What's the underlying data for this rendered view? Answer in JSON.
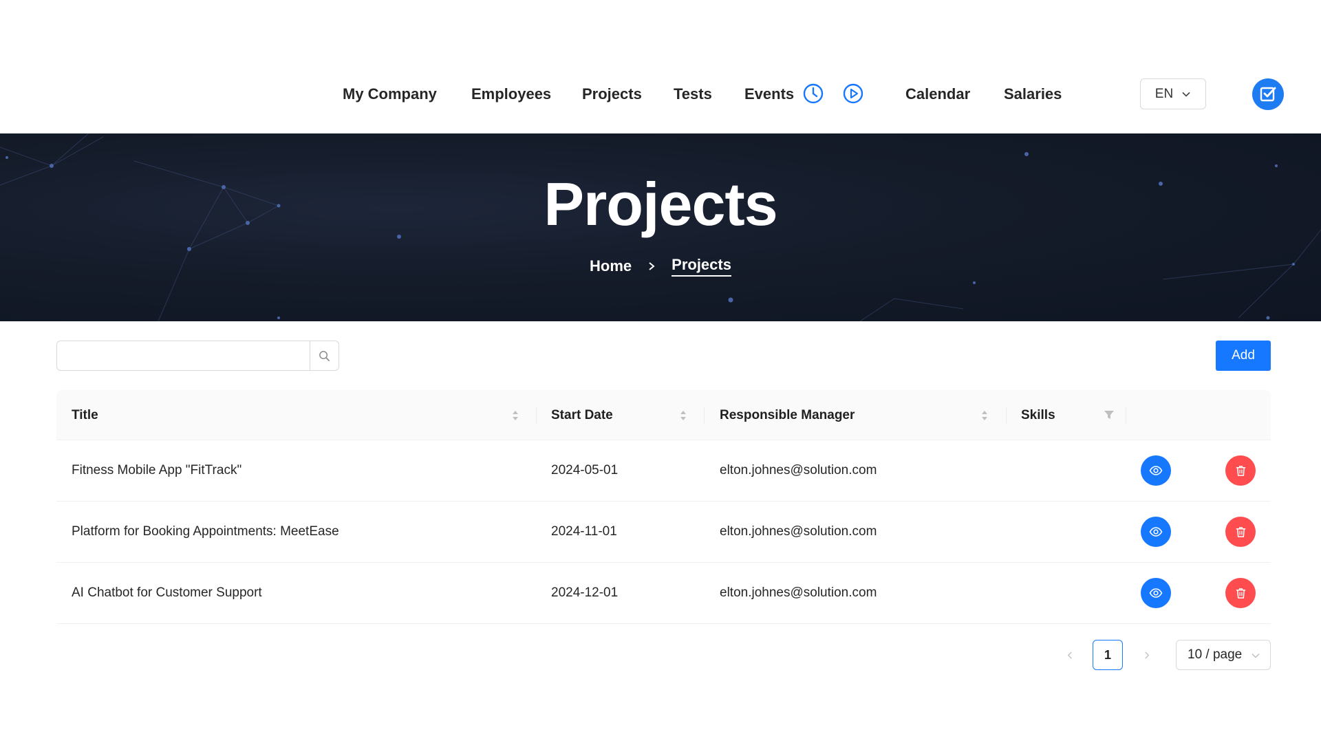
{
  "nav": {
    "items": [
      "My Company",
      "Employees",
      "Projects",
      "Tests",
      "Events",
      "Calendar",
      "Salaries"
    ],
    "icons": [
      "clock-icon",
      "play-circle-icon"
    ],
    "language": "EN",
    "tasks_icon": "checkbox-icon"
  },
  "banner": {
    "title": "Projects",
    "breadcrumb": [
      "Home",
      "Projects"
    ]
  },
  "toolbar": {
    "search_value": "",
    "search_placeholder": "",
    "add_label": "Add"
  },
  "table": {
    "columns": [
      "Title",
      "Start Date",
      "Responsible Manager",
      "Skills"
    ],
    "rows": [
      {
        "title": "Fitness Mobile App \"FitTrack\"",
        "start_date": "2024-05-01",
        "manager": "elton.johnes@solution.com",
        "skills": ""
      },
      {
        "title": "Platform for Booking Appointments: MeetEase",
        "start_date": "2024-11-01",
        "manager": "elton.johnes@solution.com",
        "skills": ""
      },
      {
        "title": "AI Chatbot for Customer Support",
        "start_date": "2024-12-01",
        "manager": "elton.johnes@solution.com",
        "skills": ""
      }
    ]
  },
  "pagination": {
    "current_page": "1",
    "page_size": "10 / page"
  },
  "colors": {
    "primary": "#1677ff",
    "danger": "#ff4d4f",
    "banner_bg": "#141b29"
  }
}
